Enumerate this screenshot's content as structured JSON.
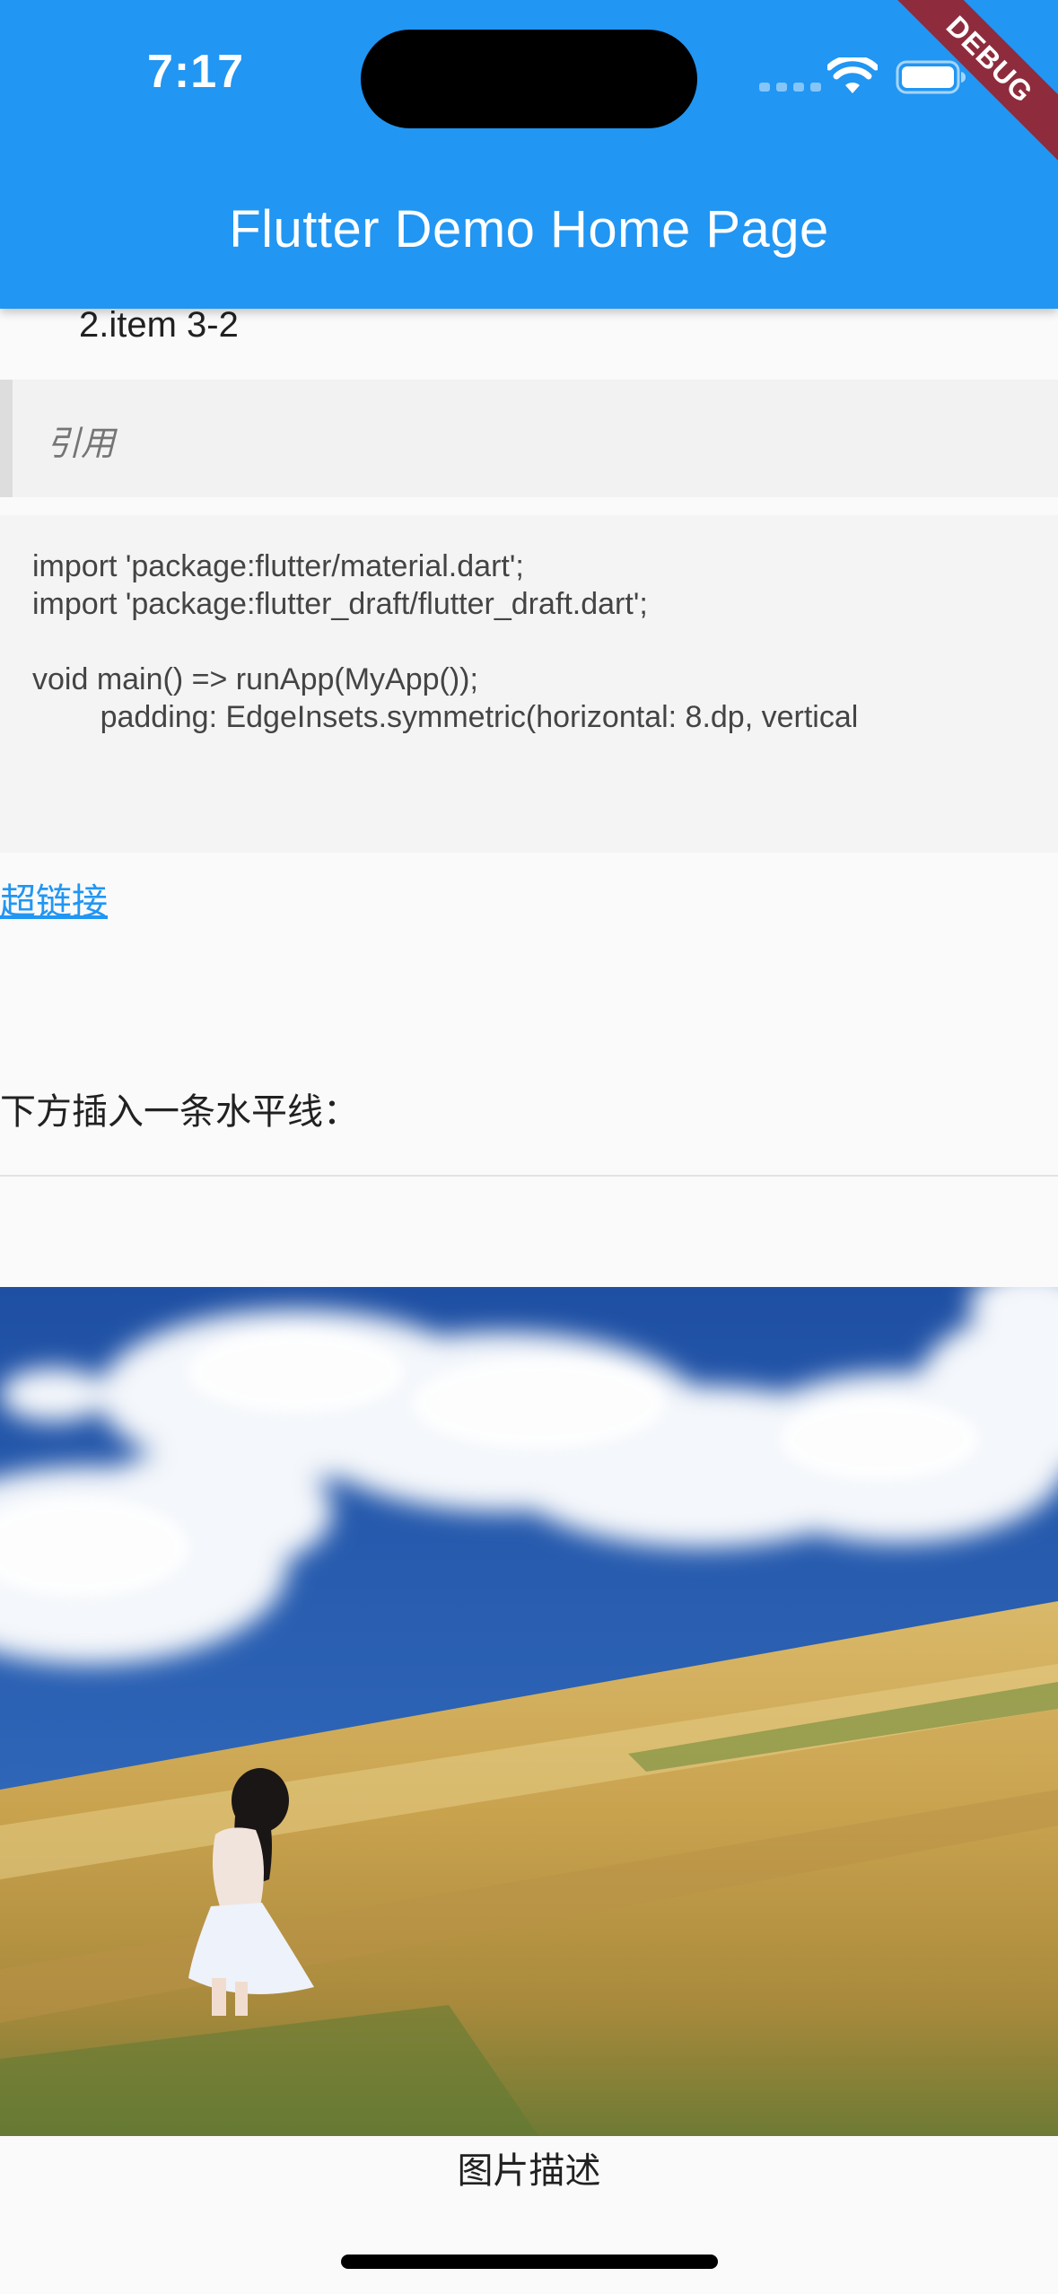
{
  "status_bar": {
    "time": "7:17",
    "icons": [
      "cellular-signal-icon",
      "wifi-icon",
      "battery-icon"
    ]
  },
  "app_bar": {
    "title": "Flutter Demo Home Page",
    "background_color": "#2196F3",
    "debug_banner": "DEBUG",
    "debug_banner_color": "#8E2C3D"
  },
  "content": {
    "list_item": "2.item 3-2",
    "blockquote": "引用",
    "code_lines": [
      "import 'package:flutter/material.dart';",
      "import 'package:flutter_draft/flutter_draft.dart';",
      "void main() => runApp(MyApp());",
      "        padding: EdgeInsets.symmetric(horizontal: 8.dp, vertical"
    ],
    "hyperlink": "超链接",
    "link_color": "#2196F3",
    "hr_label": "下方插入一条水平线：",
    "image_caption": "图片描述"
  }
}
